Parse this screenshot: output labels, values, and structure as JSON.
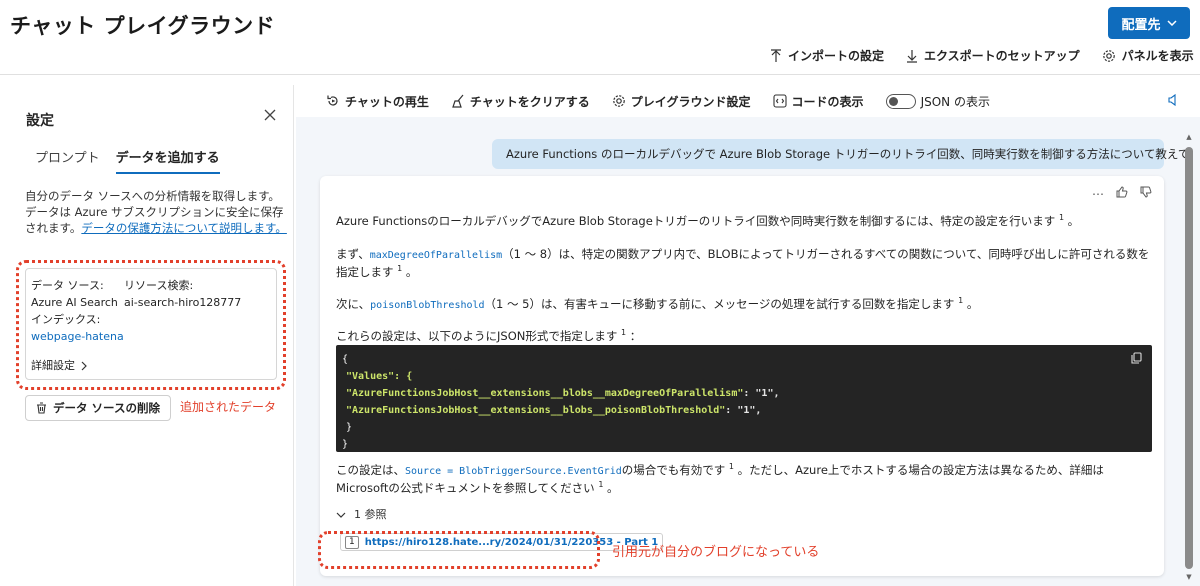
{
  "header": {
    "title": "チャット プレイグラウンド",
    "deploy_label": "配置先",
    "import_label": "インポートの設定",
    "export_label": "エクスポートのセットアップ",
    "panel_label": "パネルを表示"
  },
  "settings": {
    "title": "設定",
    "tabs": [
      {
        "label": "プロンプト"
      },
      {
        "label": "データを追加する"
      }
    ],
    "description": "自分のデータ ソースへの分析情報を取得します。データは Azure サブスクリプションに安全に保存されます。",
    "description_link": "データの保護方法について説明します。",
    "datasource_label": "データ ソース:",
    "datasource_value": "Azure AI Search",
    "resource_label": "リソース検索:",
    "resource_value": "ai-search-hiro128777",
    "index_label": "インデックス:",
    "index_value": "webpage-hatena",
    "advanced_label": "詳細設定",
    "delete_label": "データ ソースの削除",
    "annotation": "追加されたデータ"
  },
  "toolbar": {
    "replay_label": "チャットの再生",
    "clear_label": "チャットをクリアする",
    "playground_settings_label": "プレイグラウンド設定",
    "view_code_label": "コードの表示",
    "json_label": "JSON の表示"
  },
  "chat": {
    "user_message": "Azure Functions のローカルデバッグで Azure Blob Storage トリガーのリトライ回数、同時実行数を制御する方法について教えて",
    "p1": "Azure FunctionsのローカルデバッグでAzure Blob Storageトリガーのリトライ回数や同時実行数を制御するには、特定の設定を行います",
    "p2_pre": "まず、",
    "p2_code": "maxDegreeOfParallelism",
    "p2_post": "（1 ～ 8）は、特定の関数アプリ内で、BLOBによってトリガーされるすべての関数について、同時呼び出しに許可される数を指定します",
    "p3_pre": "次に、",
    "p3_code": "poisonBlobThreshold",
    "p3_post": "（1 ～ 5）は、有害キューに移動する前に、メッセージの処理を試行する回数を指定します",
    "p4": "これらの設定は、以下のようにJSON形式で指定します",
    "code_lines": [
      "{",
      "\"Values\": {",
      "\"AzureFunctionsJobHost__extensions__blobs__maxDegreeOfParallelism\"",
      "\"AzureFunctionsJobHost__extensions__blobs__poisonBlobThreshold\"",
      "}",
      "}"
    ],
    "code_value": "\"1\"",
    "p5_pre": "この設定は、",
    "p5_code": "Source = BlobTriggerSource.EventGrid",
    "p5_mid": "の場合でも有効です",
    "p5_post": "。ただし、Azure上でホストする場合の設定方法は異なるため、詳細はMicrosoftの公式ドキュメントを参照してください",
    "cite": "1",
    "refs_label": "1 参照",
    "ref_num": "1",
    "ref_url": "https://hiro128.hate...ry/2024/01/31/220353 - Part 1",
    "annotation": "引用元が自分のブログになっている"
  }
}
